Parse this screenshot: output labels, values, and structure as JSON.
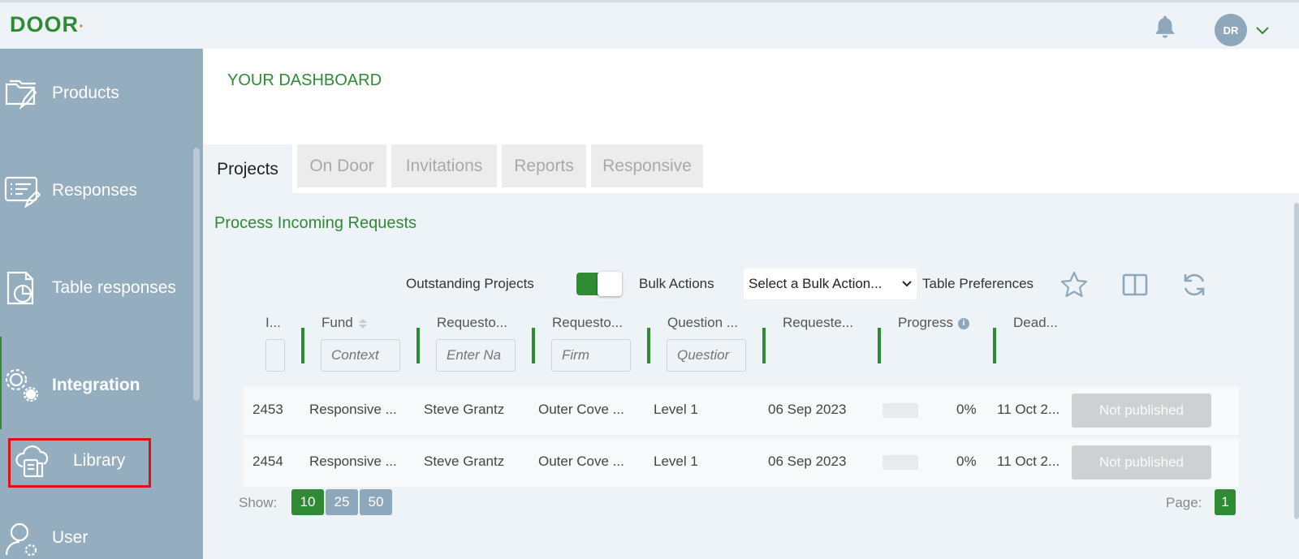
{
  "app": {
    "logo_text": "DOOR",
    "logo_dot": "·",
    "avatar_initials": "DR"
  },
  "sidebar": {
    "items": [
      {
        "label": "Products",
        "icon": "folder-edit-icon"
      },
      {
        "label": "Responses",
        "icon": "list-edit-icon"
      },
      {
        "label": "Table responses",
        "icon": "pie-document-icon"
      },
      {
        "label": "Integration",
        "icon": "gears-icon"
      },
      {
        "label": "Library",
        "icon": "cloud-library-icon"
      },
      {
        "label": "User",
        "icon": "user-gear-icon"
      }
    ]
  },
  "dashboard": {
    "title": "YOUR DASHBOARD"
  },
  "tabs": [
    {
      "label": "Projects",
      "active": true
    },
    {
      "label": "On Door",
      "active": false
    },
    {
      "label": "Invitations",
      "active": false
    },
    {
      "label": "Reports",
      "active": false
    },
    {
      "label": "Responsive",
      "active": false
    }
  ],
  "section": {
    "title": "Process Incoming Requests"
  },
  "controls": {
    "outstanding_label": "Outstanding Projects",
    "outstanding_on": true,
    "bulk_label": "Bulk Actions",
    "bulk_select_value": "Select a Bulk Action...",
    "table_prefs_label": "Table Preferences"
  },
  "table": {
    "columns": [
      {
        "label": "I...",
        "filter": ""
      },
      {
        "label": "Fund",
        "filter": "Context"
      },
      {
        "label": "Requesto...",
        "filter": "Enter Na"
      },
      {
        "label": "Requesto...",
        "filter": "Firm"
      },
      {
        "label": "Question ...",
        "filter": "Questior"
      },
      {
        "label": "Requeste...",
        "filter": ""
      },
      {
        "label": "Progress",
        "filter": ""
      },
      {
        "label": "Dead...",
        "filter": ""
      }
    ],
    "rows": [
      {
        "id": "2453",
        "fund": "Responsive ...",
        "requestor": "Steve Grantz",
        "firm": "Outer Cove ...",
        "question": "Level 1",
        "requested": "06 Sep 2023",
        "progress": "0%",
        "deadline": "11 Oct 2...",
        "status": "Not published"
      },
      {
        "id": "2454",
        "fund": "Responsive ...",
        "requestor": "Steve Grantz",
        "firm": "Outer Cove ...",
        "question": "Level 1",
        "requested": "06 Sep 2023",
        "progress": "0%",
        "deadline": "11 Oct 2...",
        "status": "Not published"
      }
    ]
  },
  "pagination": {
    "show_label": "Show:",
    "sizes": [
      "10",
      "25",
      "50"
    ],
    "active_size": "10",
    "page_label": "Page:",
    "current_page": "1"
  },
  "colors": {
    "brand": "#2f8a34",
    "sidebar": "#94adbf",
    "accent_dot": "#e07b26",
    "highlight": "#e0101a"
  }
}
